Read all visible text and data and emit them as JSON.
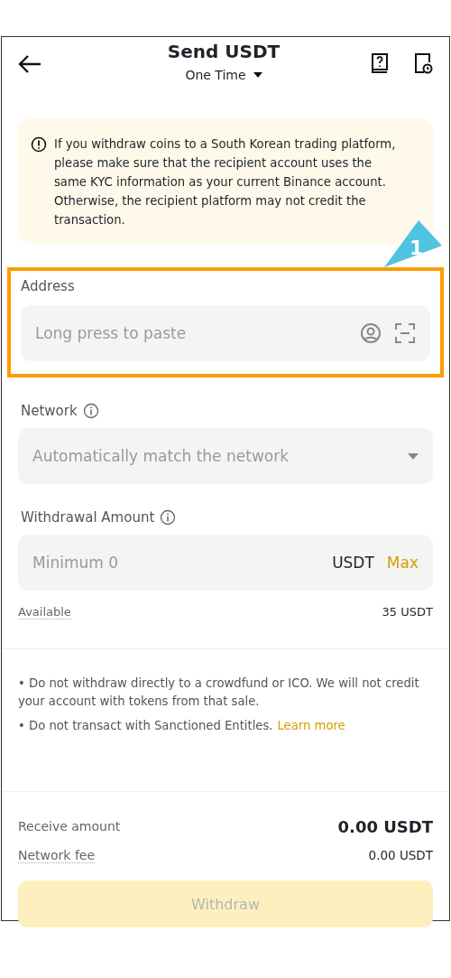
{
  "header": {
    "title": "Send USDT",
    "mode": "One Time"
  },
  "notice": "If you withdraw coins to a South Korean trading platform, please make sure that the recipient account uses the same KYC information as your current Binance account. Otherwise, the recipient platform may not credit the transaction.",
  "callout": {
    "number": "1",
    "highlighted": true
  },
  "address": {
    "label": "Address",
    "placeholder": "Long press to paste"
  },
  "network": {
    "label": "Network",
    "placeholder": "Automatically match the network"
  },
  "amount": {
    "label": "Withdrawal Amount",
    "placeholder": "Minimum 0",
    "unit": "USDT",
    "max": "Max"
  },
  "available": {
    "label": "Available",
    "value": "35 USDT"
  },
  "notes": [
    {
      "text": "• Do not withdraw directly to a crowdfund or ICO. We will not credit your account with tokens from that sale."
    },
    {
      "text": "• Do not transact with Sanctioned Entitles.",
      "link": "Learn more"
    }
  ],
  "summary": [
    {
      "label": "Receive amount",
      "value": "0.00 USDT",
      "emphasis": true
    },
    {
      "label": "Network fee",
      "value": "0.00 USDT",
      "emphasis": false
    }
  ],
  "withdraw_button": {
    "label": "Withdraw",
    "disabled": true
  }
}
